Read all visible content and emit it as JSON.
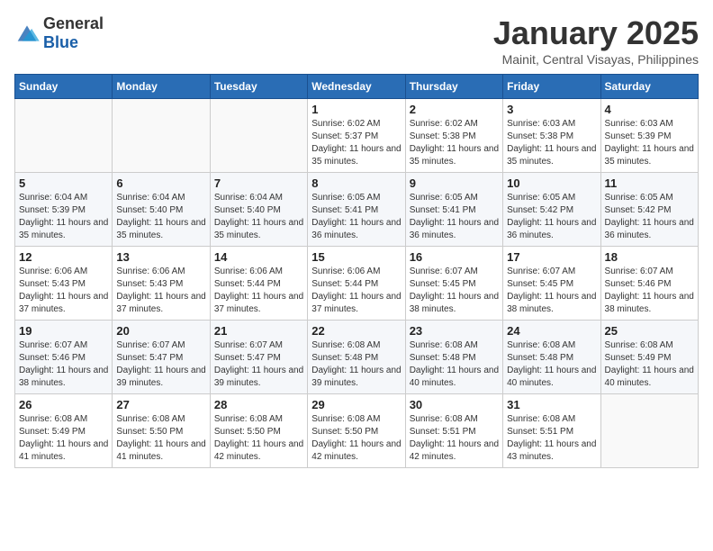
{
  "logo": {
    "general": "General",
    "blue": "Blue"
  },
  "header": {
    "month": "January 2025",
    "location": "Mainit, Central Visayas, Philippines"
  },
  "weekdays": [
    "Sunday",
    "Monday",
    "Tuesday",
    "Wednesday",
    "Thursday",
    "Friday",
    "Saturday"
  ],
  "weeks": [
    [
      {
        "day": "",
        "sunrise": "",
        "sunset": "",
        "daylight": ""
      },
      {
        "day": "",
        "sunrise": "",
        "sunset": "",
        "daylight": ""
      },
      {
        "day": "",
        "sunrise": "",
        "sunset": "",
        "daylight": ""
      },
      {
        "day": "1",
        "sunrise": "Sunrise: 6:02 AM",
        "sunset": "Sunset: 5:37 PM",
        "daylight": "Daylight: 11 hours and 35 minutes."
      },
      {
        "day": "2",
        "sunrise": "Sunrise: 6:02 AM",
        "sunset": "Sunset: 5:38 PM",
        "daylight": "Daylight: 11 hours and 35 minutes."
      },
      {
        "day": "3",
        "sunrise": "Sunrise: 6:03 AM",
        "sunset": "Sunset: 5:38 PM",
        "daylight": "Daylight: 11 hours and 35 minutes."
      },
      {
        "day": "4",
        "sunrise": "Sunrise: 6:03 AM",
        "sunset": "Sunset: 5:39 PM",
        "daylight": "Daylight: 11 hours and 35 minutes."
      }
    ],
    [
      {
        "day": "5",
        "sunrise": "Sunrise: 6:04 AM",
        "sunset": "Sunset: 5:39 PM",
        "daylight": "Daylight: 11 hours and 35 minutes."
      },
      {
        "day": "6",
        "sunrise": "Sunrise: 6:04 AM",
        "sunset": "Sunset: 5:40 PM",
        "daylight": "Daylight: 11 hours and 35 minutes."
      },
      {
        "day": "7",
        "sunrise": "Sunrise: 6:04 AM",
        "sunset": "Sunset: 5:40 PM",
        "daylight": "Daylight: 11 hours and 35 minutes."
      },
      {
        "day": "8",
        "sunrise": "Sunrise: 6:05 AM",
        "sunset": "Sunset: 5:41 PM",
        "daylight": "Daylight: 11 hours and 36 minutes."
      },
      {
        "day": "9",
        "sunrise": "Sunrise: 6:05 AM",
        "sunset": "Sunset: 5:41 PM",
        "daylight": "Daylight: 11 hours and 36 minutes."
      },
      {
        "day": "10",
        "sunrise": "Sunrise: 6:05 AM",
        "sunset": "Sunset: 5:42 PM",
        "daylight": "Daylight: 11 hours and 36 minutes."
      },
      {
        "day": "11",
        "sunrise": "Sunrise: 6:05 AM",
        "sunset": "Sunset: 5:42 PM",
        "daylight": "Daylight: 11 hours and 36 minutes."
      }
    ],
    [
      {
        "day": "12",
        "sunrise": "Sunrise: 6:06 AM",
        "sunset": "Sunset: 5:43 PM",
        "daylight": "Daylight: 11 hours and 37 minutes."
      },
      {
        "day": "13",
        "sunrise": "Sunrise: 6:06 AM",
        "sunset": "Sunset: 5:43 PM",
        "daylight": "Daylight: 11 hours and 37 minutes."
      },
      {
        "day": "14",
        "sunrise": "Sunrise: 6:06 AM",
        "sunset": "Sunset: 5:44 PM",
        "daylight": "Daylight: 11 hours and 37 minutes."
      },
      {
        "day": "15",
        "sunrise": "Sunrise: 6:06 AM",
        "sunset": "Sunset: 5:44 PM",
        "daylight": "Daylight: 11 hours and 37 minutes."
      },
      {
        "day": "16",
        "sunrise": "Sunrise: 6:07 AM",
        "sunset": "Sunset: 5:45 PM",
        "daylight": "Daylight: 11 hours and 38 minutes."
      },
      {
        "day": "17",
        "sunrise": "Sunrise: 6:07 AM",
        "sunset": "Sunset: 5:45 PM",
        "daylight": "Daylight: 11 hours and 38 minutes."
      },
      {
        "day": "18",
        "sunrise": "Sunrise: 6:07 AM",
        "sunset": "Sunset: 5:46 PM",
        "daylight": "Daylight: 11 hours and 38 minutes."
      }
    ],
    [
      {
        "day": "19",
        "sunrise": "Sunrise: 6:07 AM",
        "sunset": "Sunset: 5:46 PM",
        "daylight": "Daylight: 11 hours and 38 minutes."
      },
      {
        "day": "20",
        "sunrise": "Sunrise: 6:07 AM",
        "sunset": "Sunset: 5:47 PM",
        "daylight": "Daylight: 11 hours and 39 minutes."
      },
      {
        "day": "21",
        "sunrise": "Sunrise: 6:07 AM",
        "sunset": "Sunset: 5:47 PM",
        "daylight": "Daylight: 11 hours and 39 minutes."
      },
      {
        "day": "22",
        "sunrise": "Sunrise: 6:08 AM",
        "sunset": "Sunset: 5:48 PM",
        "daylight": "Daylight: 11 hours and 39 minutes."
      },
      {
        "day": "23",
        "sunrise": "Sunrise: 6:08 AM",
        "sunset": "Sunset: 5:48 PM",
        "daylight": "Daylight: 11 hours and 40 minutes."
      },
      {
        "day": "24",
        "sunrise": "Sunrise: 6:08 AM",
        "sunset": "Sunset: 5:48 PM",
        "daylight": "Daylight: 11 hours and 40 minutes."
      },
      {
        "day": "25",
        "sunrise": "Sunrise: 6:08 AM",
        "sunset": "Sunset: 5:49 PM",
        "daylight": "Daylight: 11 hours and 40 minutes."
      }
    ],
    [
      {
        "day": "26",
        "sunrise": "Sunrise: 6:08 AM",
        "sunset": "Sunset: 5:49 PM",
        "daylight": "Daylight: 11 hours and 41 minutes."
      },
      {
        "day": "27",
        "sunrise": "Sunrise: 6:08 AM",
        "sunset": "Sunset: 5:50 PM",
        "daylight": "Daylight: 11 hours and 41 minutes."
      },
      {
        "day": "28",
        "sunrise": "Sunrise: 6:08 AM",
        "sunset": "Sunset: 5:50 PM",
        "daylight": "Daylight: 11 hours and 42 minutes."
      },
      {
        "day": "29",
        "sunrise": "Sunrise: 6:08 AM",
        "sunset": "Sunset: 5:50 PM",
        "daylight": "Daylight: 11 hours and 42 minutes."
      },
      {
        "day": "30",
        "sunrise": "Sunrise: 6:08 AM",
        "sunset": "Sunset: 5:51 PM",
        "daylight": "Daylight: 11 hours and 42 minutes."
      },
      {
        "day": "31",
        "sunrise": "Sunrise: 6:08 AM",
        "sunset": "Sunset: 5:51 PM",
        "daylight": "Daylight: 11 hours and 43 minutes."
      },
      {
        "day": "",
        "sunrise": "",
        "sunset": "",
        "daylight": ""
      }
    ]
  ]
}
